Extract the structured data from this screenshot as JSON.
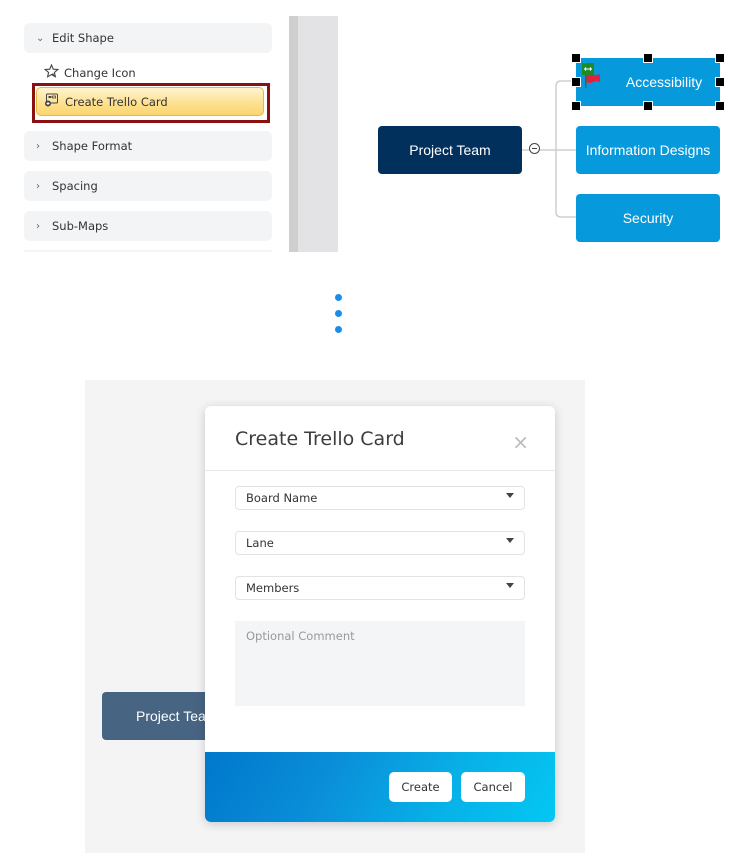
{
  "panel": {
    "sections": [
      {
        "label": "Edit Shape",
        "expanded": true
      },
      {
        "label": "Shape Format",
        "expanded": false
      },
      {
        "label": "Spacing",
        "expanded": false
      },
      {
        "label": "Sub-Maps",
        "expanded": false
      }
    ],
    "subitems": [
      {
        "label": "Change Icon",
        "icon": "star-icon"
      },
      {
        "label": "Create Trello Card",
        "icon": "trello-card-icon",
        "highlighted": true
      }
    ]
  },
  "mindmap": {
    "root": "Project Team",
    "children": [
      "Accessibility",
      "Information Designs",
      "Security"
    ],
    "selected": "Accessibility",
    "colors": {
      "root": "#02305c",
      "child": "#0699db"
    }
  },
  "dialog": {
    "title": "Create Trello Card",
    "close_label": "×",
    "fields": [
      {
        "placeholder": "Board Name"
      },
      {
        "placeholder": "Lane"
      },
      {
        "placeholder": "Members"
      }
    ],
    "comment_placeholder": "Optional Comment",
    "create_label": "Create",
    "cancel_label": "Cancel"
  },
  "background_node": "Project Team"
}
